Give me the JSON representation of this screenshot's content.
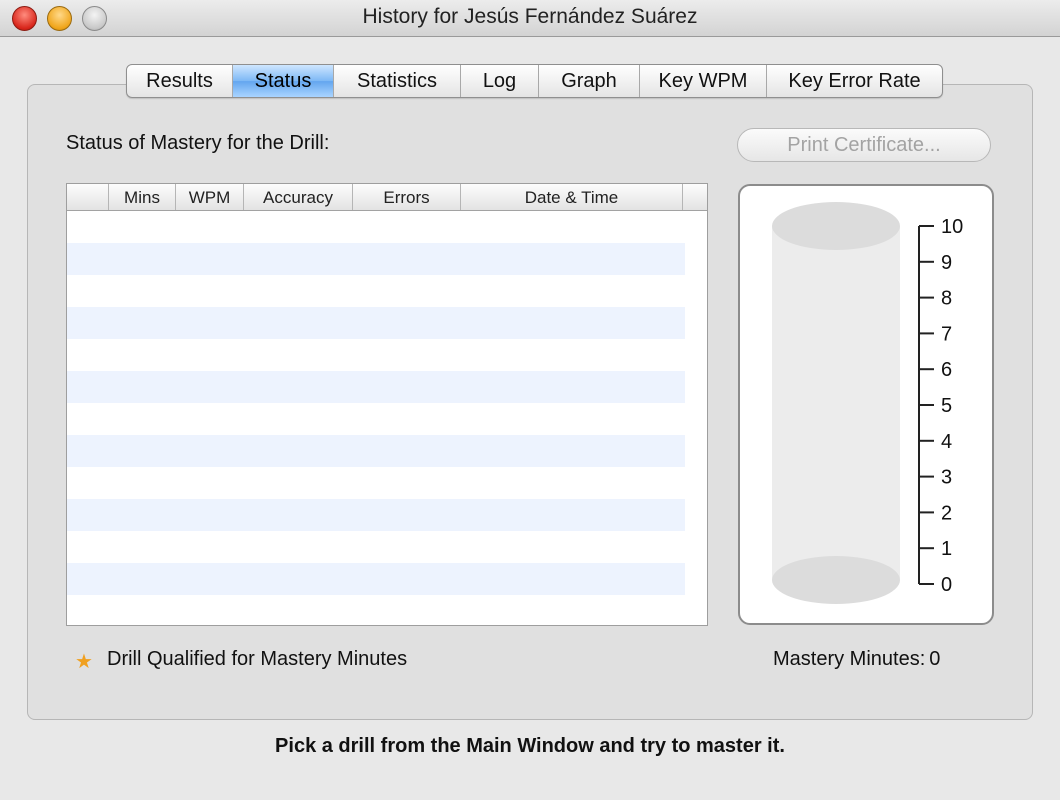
{
  "window": {
    "title": "History for Jesús Fernández Suárez"
  },
  "tabs": [
    {
      "label": "Results",
      "active": false
    },
    {
      "label": "Status",
      "active": true
    },
    {
      "label": "Statistics",
      "active": false
    },
    {
      "label": "Log",
      "active": false
    },
    {
      "label": "Graph",
      "active": false
    },
    {
      "label": "Key WPM",
      "active": false
    },
    {
      "label": "Key Error Rate",
      "active": false
    }
  ],
  "status": {
    "section_label": "Status of Mastery for the Drill:",
    "print_button": "Print Certificate...",
    "table": {
      "columns": [
        "",
        "Mins",
        "WPM",
        "Accuracy",
        "Errors",
        "Date & Time",
        ""
      ],
      "rows": []
    },
    "gauge": {
      "ticks": [
        "10",
        "9",
        "8",
        "7",
        "6",
        "5",
        "4",
        "3",
        "2",
        "1",
        "0"
      ],
      "value": 0
    },
    "qualified_label": "Drill Qualified for Mastery Minutes",
    "mastery_minutes_label": "Mastery Minutes:",
    "mastery_minutes_value": "0"
  },
  "footer": {
    "message": "Pick a drill from the Main Window and try to master it."
  },
  "colors": {
    "active_tab": "#7db8f5",
    "alt_row": "#edf3fe",
    "star": "#f0a020"
  }
}
